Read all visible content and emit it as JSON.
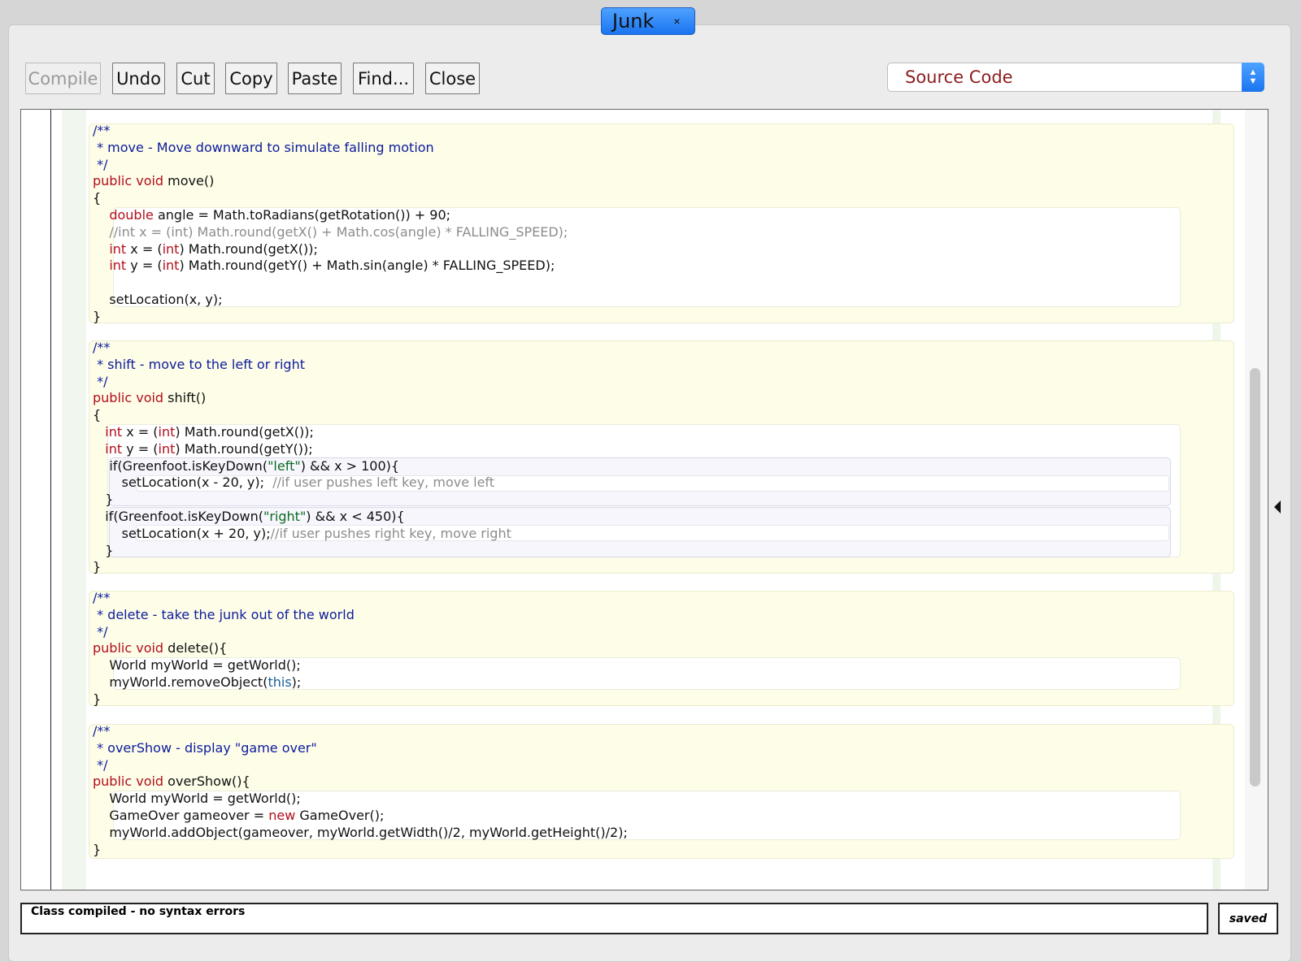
{
  "tab": {
    "title": "Junk",
    "close": "×"
  },
  "toolbar": {
    "compile": "Compile",
    "undo": "Undo",
    "cut": "Cut",
    "copy": "Copy",
    "paste": "Paste",
    "find": "Find...",
    "close": "Close"
  },
  "view_select": {
    "value": "Source Code"
  },
  "code": {
    "move": {
      "doc_open": "/**",
      "doc_text": " * move - Move downward to simulate falling motion",
      "doc_close": " */",
      "sig_kw": "public void",
      "sig_rest": " move()",
      "open_brace": "{",
      "l1_kw": "double",
      "l1_rest": " angle = Math.toRadians(getRotation()) + 90;",
      "l2_comment": "//int x = (int) Math.round(getX() + Math.cos(angle) * FALLING_SPEED);",
      "l3_kw": "int",
      "l3_a": " x = (",
      "l3_kw2": "int",
      "l3_b": ") Math.round(getX());",
      "l4_kw": "int",
      "l4_a": " y = (",
      "l4_kw2": "int",
      "l4_b": ") Math.round(getY() + Math.sin(angle) * FALLING_SPEED);",
      "l5": "setLocation(x, y);",
      "close_brace": "}"
    },
    "shift": {
      "doc_open": "/**",
      "doc_text": " * shift - move to the left or right",
      "doc_close": " */",
      "sig_kw": "public void",
      "sig_rest": " shift()",
      "open_brace": "{",
      "l1_kw": "int",
      "l1_a": " x = (",
      "l1_kw2": "int",
      "l1_b": ") Math.round(getX());",
      "l2_kw": "int",
      "l2_a": " y = (",
      "l2_kw2": "int",
      "l2_b": ") Math.round(getY());",
      "if1_a": "if(Greenfoot.isKeyDown(",
      "if1_str": "\"left\"",
      "if1_b": ") && x > 100){",
      "if1_body": "setLocation(x - 20, y);  ",
      "if1_comment": "//if user pushes left key, move left",
      "if1_close": "}",
      "if2_a": "if(Greenfoot.isKeyDown(",
      "if2_str": "\"right\"",
      "if2_b": ") && x < 450){",
      "if2_body": "setLocation(x + 20, y);",
      "if2_comment": "//if user pushes right key, move right",
      "if2_close": "}",
      "close_brace": "}"
    },
    "delete": {
      "doc_open": "/**",
      "doc_text": " * delete - take the junk out of the world",
      "doc_close": " */",
      "sig_kw": "public void",
      "sig_rest": " delete(){",
      "l1": "World myWorld = getWorld();",
      "l2_a": "myWorld.removeObject(",
      "l2_this": "this",
      "l2_b": ");",
      "close_brace": "}"
    },
    "overShow": {
      "doc_open": "/**",
      "doc_text": " * overShow - display \"game over\"",
      "doc_close": " */",
      "sig_kw": "public void",
      "sig_rest": " overShow(){",
      "l1": "World myWorld = getWorld();",
      "l2_a": "GameOver gameover = ",
      "l2_kw": "new",
      "l2_b": " GameOver();",
      "l3": "myWorld.addObject(gameover, myWorld.getWidth()/2, myWorld.getHeight()/2);",
      "close_brace": "}"
    }
  },
  "status": {
    "message": "Class compiled - no syntax errors",
    "saved": "saved"
  },
  "colors": {
    "keyword": "#b20e1c",
    "doc_comment": "#0d1b9c",
    "comment": "#8c8c8c",
    "string": "#0b6a1f",
    "method_bg": "#fdfde8",
    "accent": "#1b74f0"
  }
}
